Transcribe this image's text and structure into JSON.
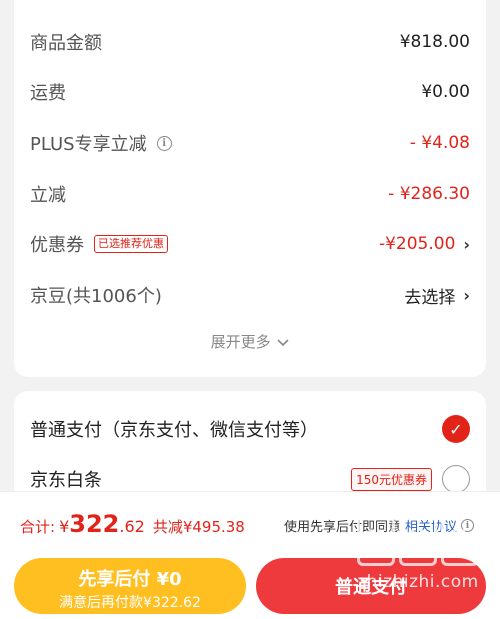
{
  "summary": {
    "goods_amount": {
      "label": "商品金额",
      "value": "¥818.00"
    },
    "shipping": {
      "label": "运费",
      "value": "¥0.00"
    },
    "plus_discount": {
      "label": "PLUS专享立减",
      "value": "- ¥4.08",
      "icon": "info-icon"
    },
    "instant_discount": {
      "label": "立减",
      "value": "- ¥286.30"
    },
    "coupon": {
      "label": "优惠券",
      "tag": "已选推荐优惠",
      "value": "-¥205.00",
      "chevron": "›"
    },
    "jd_beans": {
      "label": "京豆(共1006个)",
      "value": "去选择",
      "chevron": "›"
    },
    "expand_more": "展开更多"
  },
  "payment": {
    "normal": {
      "label": "普通支付（京东支付、微信支付等）",
      "selected": true
    },
    "baitiao": {
      "label": "京东白条",
      "coupon_tag": "150元优惠券",
      "selected": false
    }
  },
  "footer": {
    "total_label": "合计:",
    "yen": "¥",
    "amount_int": "322",
    "amount_decimal": ".62",
    "savings": "共减¥495.38",
    "agree_text": "使用先享后付即同意",
    "agree_link": "相关协议",
    "pay_later_main": "先享后付 ¥0",
    "pay_later_sub": "满意后再付款¥322.62",
    "pay_normal": "普通支付"
  },
  "watermark": {
    "logo_char": "值",
    "text": "zhizhizhi.com"
  },
  "colors": {
    "accent_red": "#e2231a",
    "pay_later_yellow": "#ffbf21",
    "pay_normal_red": "#ee3a3d",
    "link_blue": "#2a62c9"
  }
}
